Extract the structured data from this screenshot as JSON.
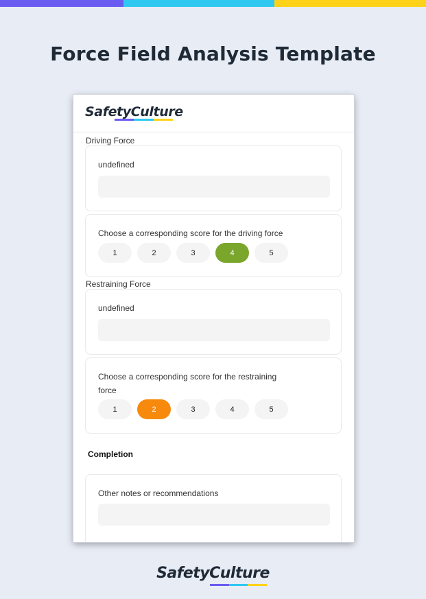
{
  "colors": {
    "bar_purple": "#6a5cf0",
    "bar_cyan": "#2ec8f0",
    "bar_yellow": "#ffd21a",
    "selected_green": "#7aa62c",
    "selected_orange": "#f7890c",
    "page_bg": "#e8ecf5"
  },
  "page_title": "Force Field Analysis Template",
  "brand": {
    "logo_text": "SafetyCulture"
  },
  "driving": {
    "section_label": "Driving Force",
    "field_label": "undefined",
    "field_value": "",
    "score_question": "Choose a corresponding score for the driving force",
    "scores": [
      "1",
      "2",
      "3",
      "4",
      "5"
    ],
    "selected": "4"
  },
  "restraining": {
    "section_label": "Restraining Force",
    "field_label": "undefined",
    "field_value": "",
    "score_question_line1": "Choose a corresponding score for the restraining",
    "score_question_line2": "force",
    "scores": [
      "1",
      "2",
      "3",
      "4",
      "5"
    ],
    "selected": "2"
  },
  "completion": {
    "heading": "Completion",
    "notes_label": "Other notes or recommendations",
    "notes_value": ""
  },
  "footer": {
    "logo_text": "SafetyCulture"
  }
}
